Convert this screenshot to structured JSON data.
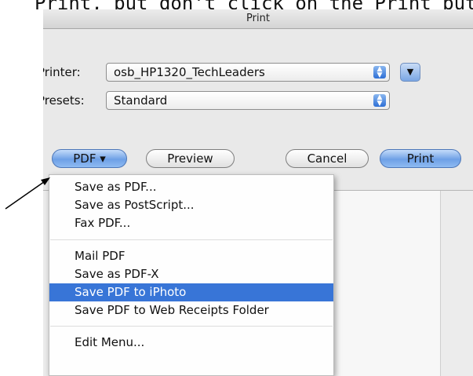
{
  "caption": "Print, but don't click on the Print button",
  "window": {
    "title": "Print"
  },
  "printer": {
    "label": "Printer:",
    "value": "osb_HP1320_TechLeaders"
  },
  "presets": {
    "label": "Presets:",
    "value": "Standard"
  },
  "buttons": {
    "pdf": "PDF ▾",
    "preview": "Preview",
    "cancel": "Cancel",
    "print": "Print"
  },
  "pdf_menu": {
    "items": [
      "Save as PDF...",
      "Save as PostScript...",
      "Fax PDF...",
      "Mail PDF",
      "Save as PDF-X",
      "Save PDF to iPhoto",
      "Save PDF to Web Receipts Folder",
      "Edit Menu..."
    ],
    "selected": "Save PDF to iPhoto"
  },
  "colors": {
    "selection": "#3875d7",
    "button_blue": "#6ea0e6"
  }
}
